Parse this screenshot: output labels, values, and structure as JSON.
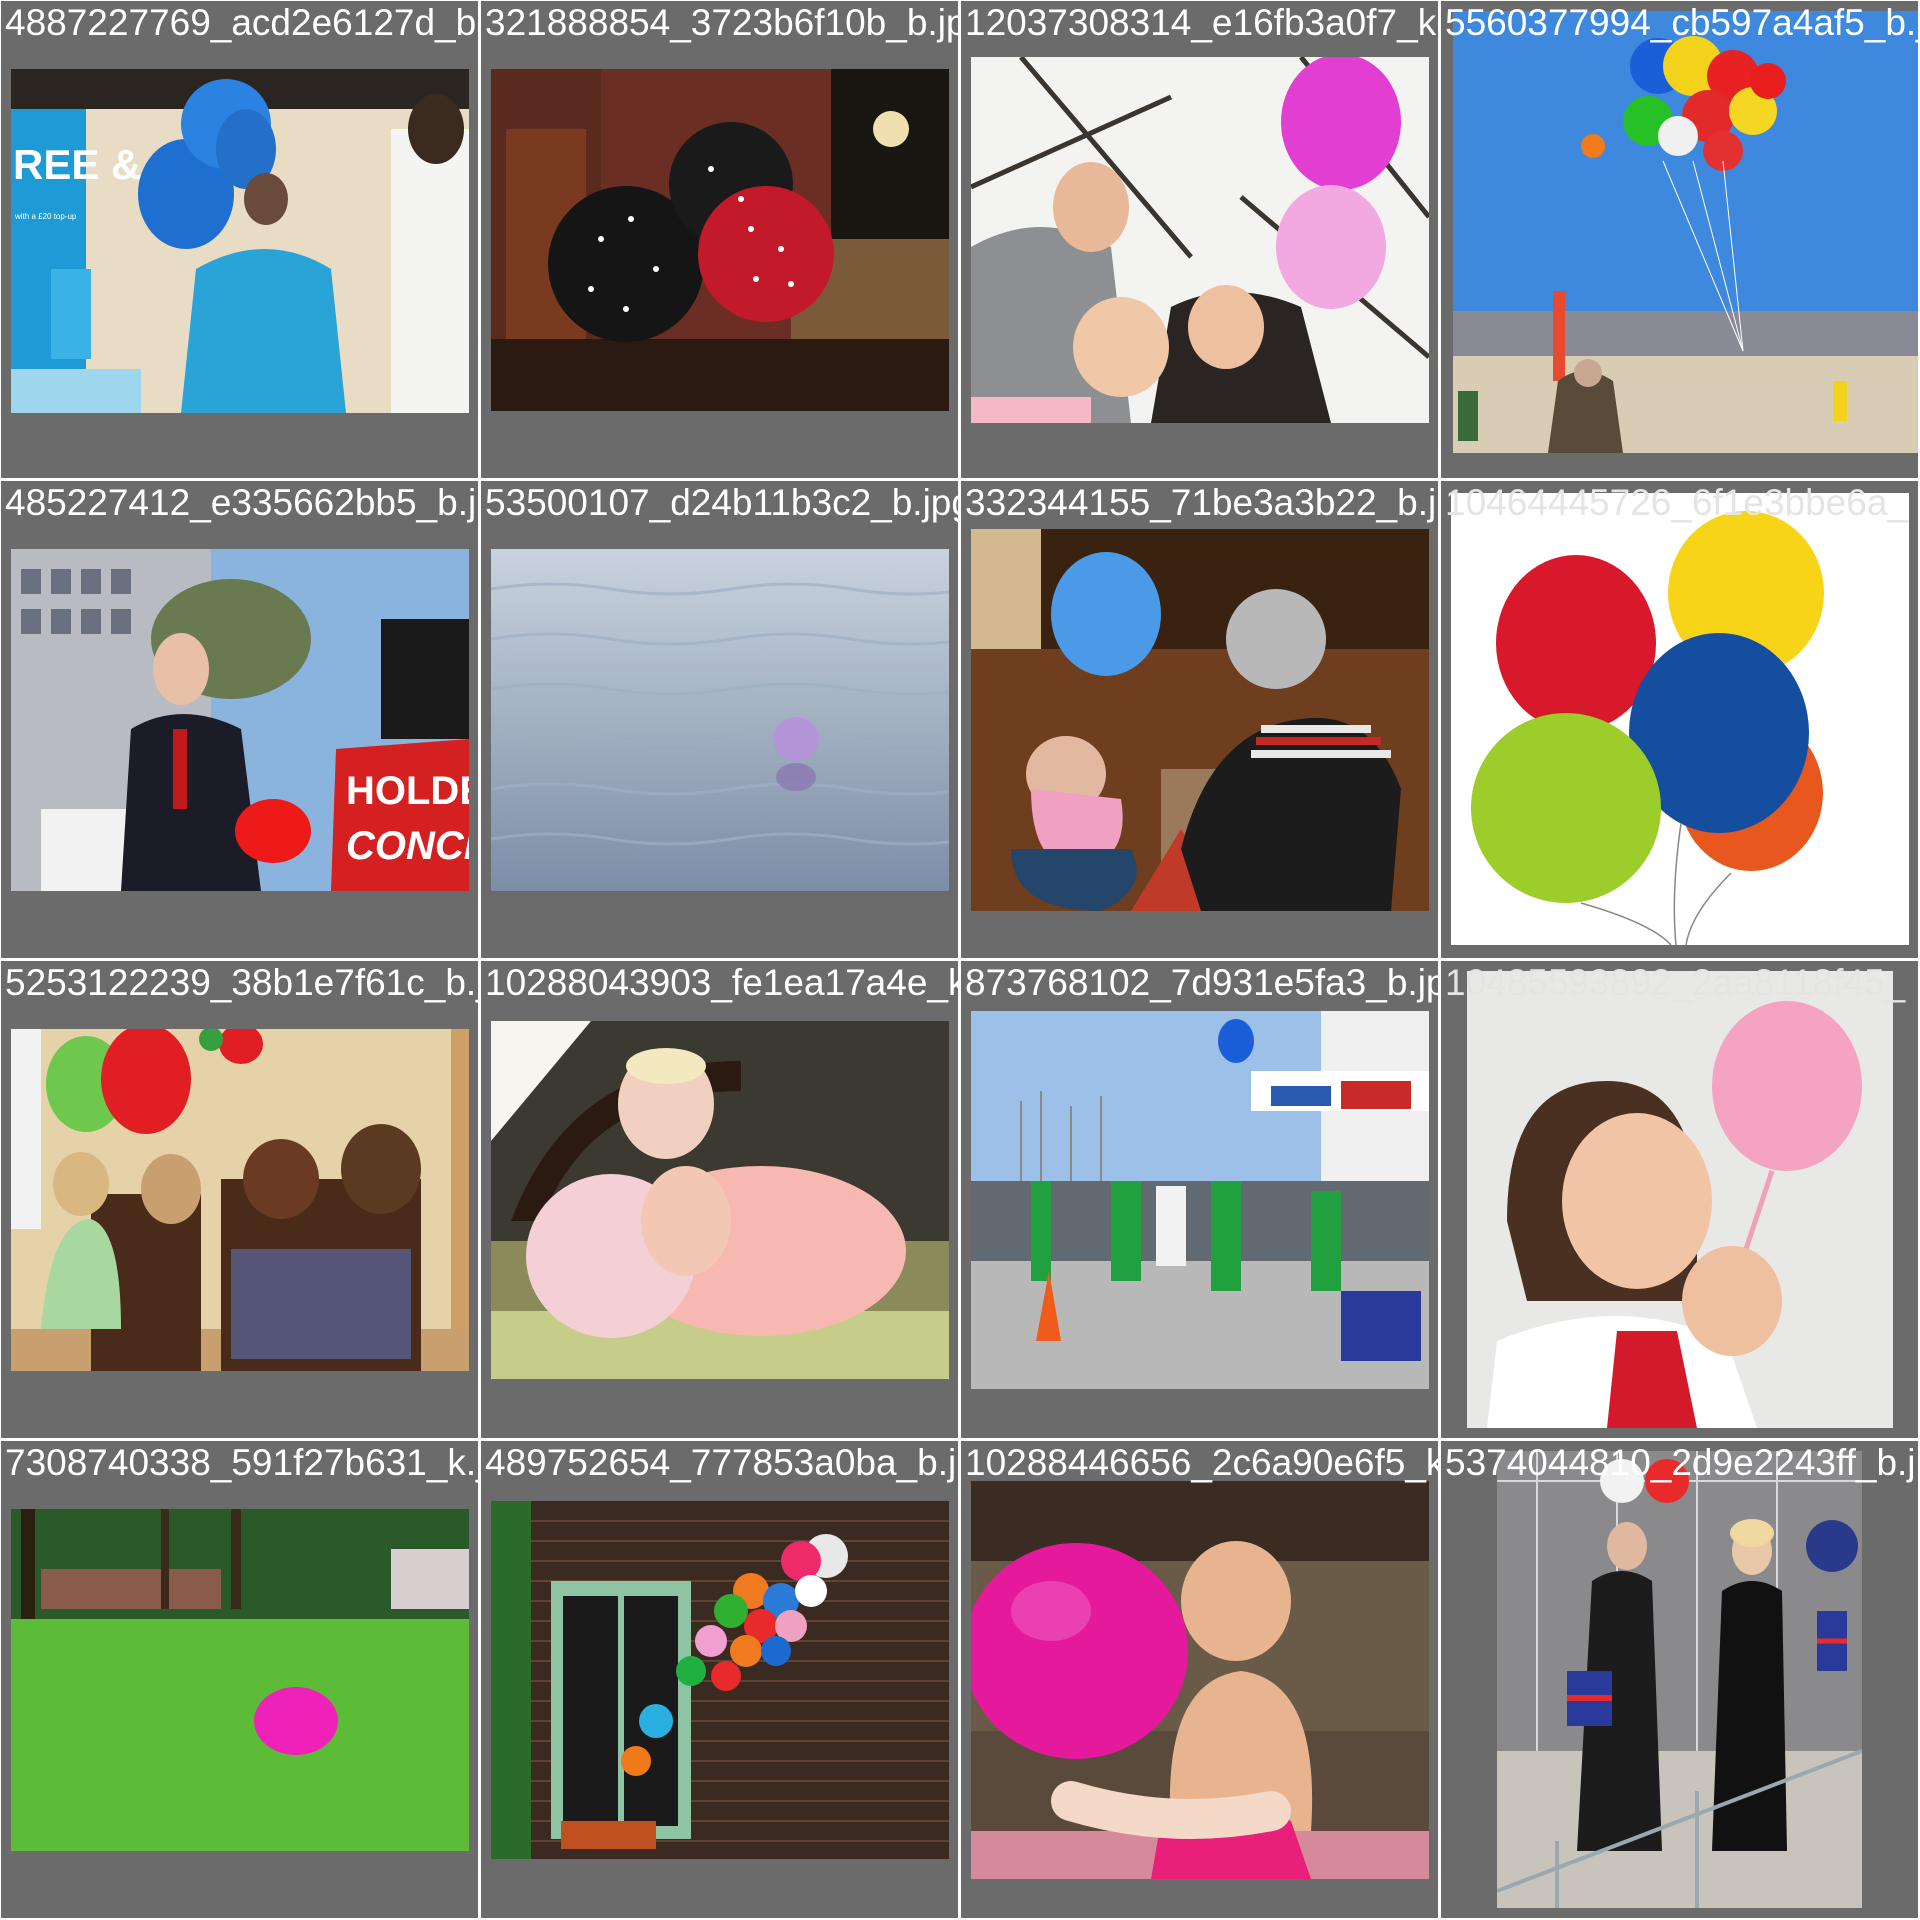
{
  "tiles": [
    {
      "filename": "4887227769_acd2e6127d_b.jpg",
      "scene": "woman in blue top holding blue balloons at a promotional booth",
      "poster_text": "REE & SMS",
      "poster_subtext": "with a £20 top-up"
    },
    {
      "filename": "321888854_3723b6f10b_b.jpg",
      "scene": "black and red star-print balloons in front of a brick wall and wooden doors"
    },
    {
      "filename": "12037308314_e16fb3a0f7_k.jpg",
      "scene": "parents with a baby under pink balloons near a window"
    },
    {
      "filename": "5560377994_cb597a4af5_b.jpg",
      "scene": "bunch of multicolored balloons lifting a person over a desert"
    },
    {
      "filename": "485227412_e335662bb5_b.jpg",
      "scene": "man in suit holding a red balloon beside a red banner",
      "banner_text_1": "HOLDEN",
      "banner_text_2": "CONCER"
    },
    {
      "filename": "53500107_d24b11b3c2_b.jpg",
      "scene": "small purple balloon floating on water"
    },
    {
      "filename": "332344155_71be3a3b22_b.jpg",
      "scene": "grandmother handing a light blue balloon to a toddler"
    },
    {
      "filename": "10464445726_6f1e3bbe6a_",
      "scene": "red, yellow, green, blue and orange balloons on white background"
    },
    {
      "filename": "5253122239_38b1e7f61c_b.jpg",
      "scene": "children at a party table with green and red balloons"
    },
    {
      "filename": "10288043903_fe1ea17a4e_k.jpg",
      "scene": "baby in pink tutu holding a pink balloon"
    },
    {
      "filename": "873768102_7d931e5fa3_b.jpg",
      "scene": "workers in green aprons at a waterfront with a blue balloon"
    },
    {
      "filename": "10485593892_2aa8118f45_",
      "scene": "girl blowing up a pink balloon"
    },
    {
      "filename": "7308740338_591f27b631_k.jpg",
      "scene": "pink balloon on green grass in a park"
    },
    {
      "filename": "489752654_777853a0ba_b.jpg",
      "scene": "colorful balloons on a brick wall beside a green window"
    },
    {
      "filename": "10288446656_2c6a90e6f5_k.jpg",
      "scene": "baby playing with a magenta balloon"
    },
    {
      "filename": "5374044810_2d9e2243ff_b.jpg",
      "scene": "women with Union Jack flags and balloons at barriers"
    }
  ]
}
